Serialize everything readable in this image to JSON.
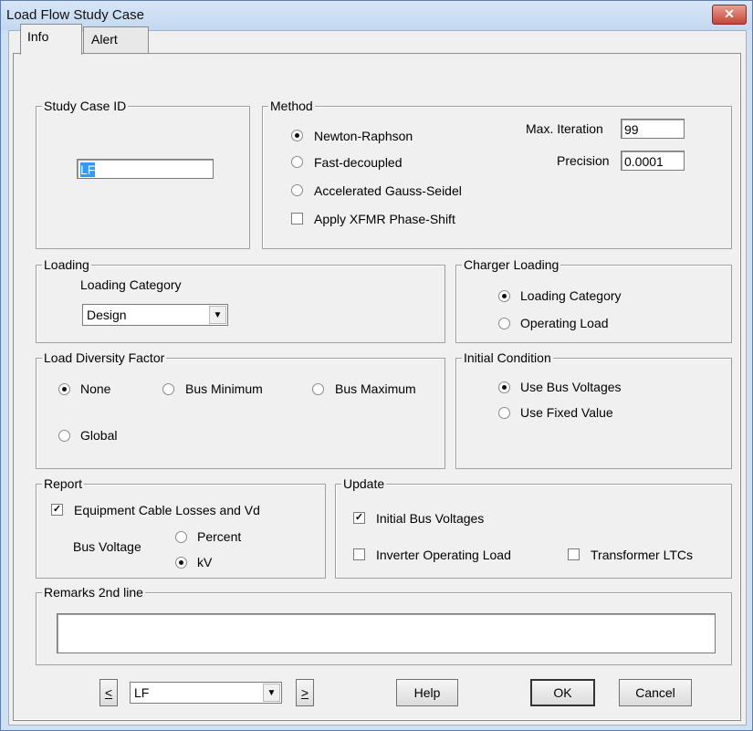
{
  "window": {
    "title": "Load Flow Study Case",
    "close_glyph": "✕"
  },
  "tabs": [
    {
      "label": "Info"
    },
    {
      "label": "Alert"
    }
  ],
  "study_case": {
    "legend": "Study Case ID",
    "value": "LF"
  },
  "method": {
    "legend": "Method",
    "options": [
      "Newton-Raphson",
      "Fast-decoupled",
      "Accelerated Gauss-Seidel"
    ],
    "selected": "Newton-Raphson",
    "apply_xfmr_label": "Apply XFMR Phase-Shift",
    "apply_xfmr_checked": false,
    "max_iteration_label": "Max. Iteration",
    "max_iteration_value": "99",
    "precision_label": "Precision",
    "precision_value": "0.0001"
  },
  "loading": {
    "legend": "Loading",
    "category_label": "Loading Category",
    "category_value": "Design"
  },
  "charger_loading": {
    "legend": "Charger Loading",
    "options": [
      "Loading Category",
      "Operating Load"
    ],
    "selected": "Loading Category"
  },
  "load_diversity": {
    "legend": "Load Diversity Factor",
    "options": [
      "None",
      "Bus Minimum",
      "Bus Maximum",
      "Global"
    ],
    "selected": "None"
  },
  "initial_condition": {
    "legend": "Initial Condition",
    "options": [
      "Use Bus Voltages",
      "Use Fixed Value"
    ],
    "selected": "Use Bus Voltages"
  },
  "report": {
    "legend": "Report",
    "equipment_label": "Equipment Cable Losses and Vd",
    "equipment_checked": true,
    "bus_voltage_label": "Bus Voltage",
    "options": [
      "Percent",
      "kV"
    ],
    "selected": "kV"
  },
  "update": {
    "legend": "Update",
    "initial_bus_label": "Initial Bus Voltages",
    "initial_bus_checked": true,
    "inverter_label": "Inverter Operating Load",
    "inverter_checked": false,
    "transformer_label": "Transformer LTCs",
    "transformer_checked": false
  },
  "remarks": {
    "legend": "Remarks 2nd line",
    "value": ""
  },
  "footer": {
    "prev_label": "<",
    "next_label": ">",
    "case_value": "LF",
    "help_label": "Help",
    "ok_label": "OK",
    "cancel_label": "Cancel"
  },
  "icons": {
    "close": "close-icon",
    "dropdown": "chevron-down-icon",
    "check": "checkmark-icon"
  }
}
